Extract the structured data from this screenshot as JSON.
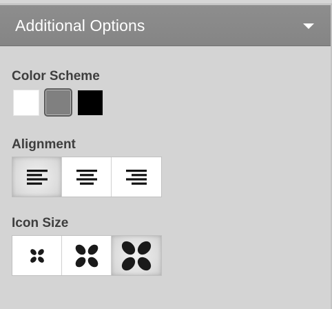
{
  "header": {
    "title": "Additional Options",
    "caret_icon": "caret-down-icon"
  },
  "color_scheme": {
    "label": "Color Scheme",
    "options": [
      {
        "name": "white",
        "color": "#ffffff",
        "selected": false
      },
      {
        "name": "gray",
        "color": "#808080",
        "selected": true
      },
      {
        "name": "black",
        "color": "#000000",
        "selected": false
      }
    ]
  },
  "alignment": {
    "label": "Alignment",
    "options": [
      {
        "name": "align-left-icon",
        "selected": true
      },
      {
        "name": "align-center-icon",
        "selected": false
      },
      {
        "name": "align-right-icon",
        "selected": false
      }
    ]
  },
  "icon_size": {
    "label": "Icon Size",
    "options": [
      {
        "name": "small-size-icon",
        "selected": false
      },
      {
        "name": "medium-size-icon",
        "selected": false
      },
      {
        "name": "large-size-icon",
        "selected": true
      }
    ]
  }
}
